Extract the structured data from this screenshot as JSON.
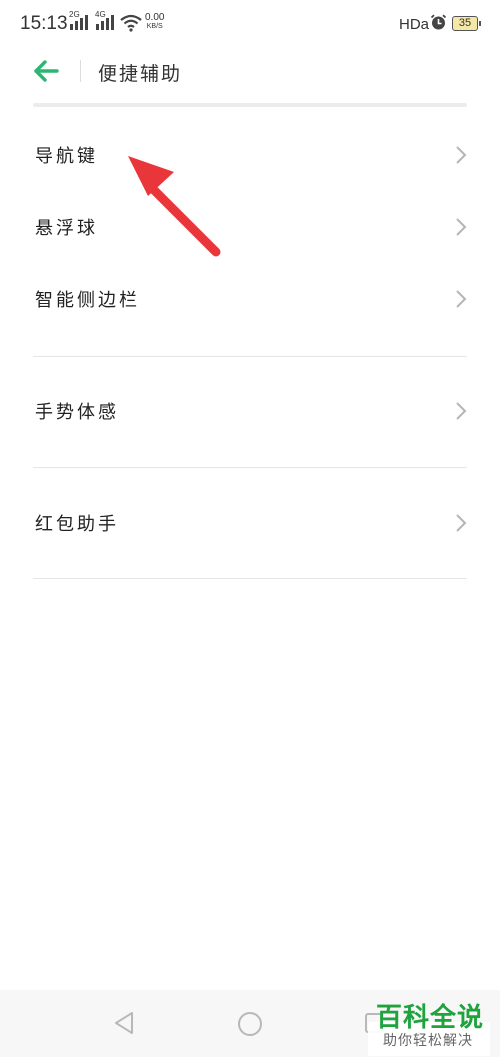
{
  "status_bar": {
    "time": "15:13",
    "signal1_tag": "2G",
    "signal2_tag": "4G",
    "net_speed_value": "0.00",
    "net_speed_unit": "KB/S",
    "hd_label": "HDa",
    "battery_level": "35",
    "icons": [
      "signal-icon",
      "wifi-icon",
      "alarm-icon",
      "battery-icon"
    ]
  },
  "header": {
    "title": "便捷辅助",
    "back_icon": "back-arrow-icon",
    "accent_color": "#2bb673"
  },
  "menu": {
    "groups": [
      {
        "items": [
          {
            "label": "导航键"
          },
          {
            "label": "悬浮球"
          },
          {
            "label": "智能侧边栏"
          }
        ]
      },
      {
        "items": [
          {
            "label": "手势体感"
          }
        ]
      },
      {
        "items": [
          {
            "label": "红包助手"
          }
        ]
      }
    ],
    "chevron_icon": "chevron-right-icon"
  },
  "annotation": {
    "type": "red-arrow",
    "color": "#e8363a",
    "points_to": "导航键"
  },
  "nav_bar": {
    "icons": [
      "nav-back-icon",
      "nav-home-icon",
      "nav-recent-icon"
    ]
  },
  "watermark": {
    "title": "百科全说",
    "subtitle": "助你轻松解决",
    "color": "#1fa33d"
  }
}
